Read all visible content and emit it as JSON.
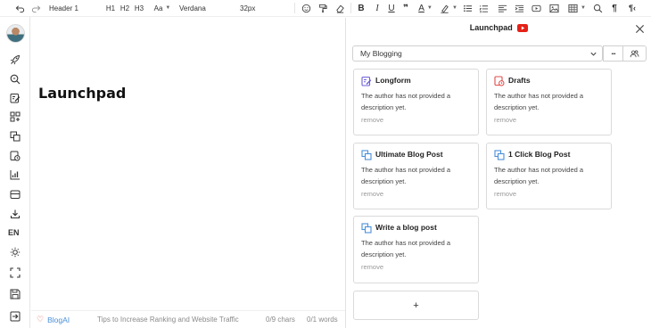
{
  "toolbar": {
    "block_type": "Header 1",
    "h1": "H1",
    "h2": "H2",
    "h3": "H3",
    "text_size_label": "Aa",
    "font_family": "Verdana",
    "font_size": "32px"
  },
  "sidebar": {
    "language": "EN"
  },
  "editor": {
    "title": "Launchpad"
  },
  "status": {
    "brand": "BlogAI",
    "tip": "Tips to Increase Ranking and Website Traffic",
    "chars": "0/9 chars",
    "words": "0/1 words"
  },
  "panel": {
    "title": "Launchpad",
    "folder": "My Blogging",
    "more_label": "...",
    "cards": [
      {
        "title": "Longform",
        "description": "The author has not provided a description yet.",
        "remove": "remove",
        "icon": "edit-document-icon"
      },
      {
        "title": "Drafts",
        "description": "The author has not provided a description yet.",
        "remove": "remove",
        "icon": "draft-clock-icon"
      },
      {
        "title": "Ultimate Blog Post",
        "description": "The author has not provided a description yet.",
        "remove": "remove",
        "icon": "copy-icon"
      },
      {
        "title": "1 Click Blog Post",
        "description": "The author has not provided a description yet.",
        "remove": "remove",
        "icon": "copy-icon"
      },
      {
        "title": "Write a blog post",
        "description": "The author has not provided a description yet.",
        "remove": "remove",
        "icon": "copy-icon"
      }
    ],
    "add_label": "+"
  },
  "colors": {
    "accent_blue": "#4a90d9",
    "youtube_red": "#e62117",
    "icon_purple": "#6b5fd3",
    "icon_red": "#e04b4b"
  }
}
